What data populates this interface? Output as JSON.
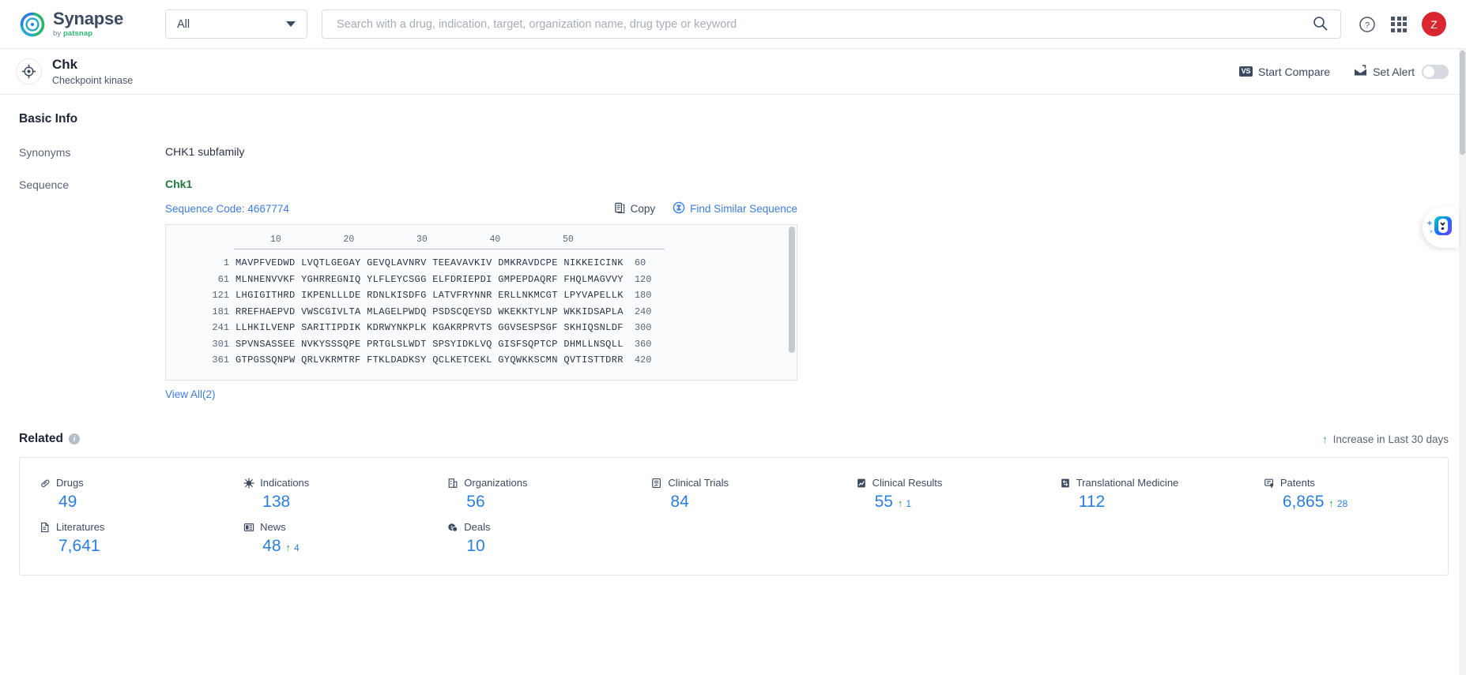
{
  "header": {
    "logo_name": "Synapse",
    "logo_sub_prefix": "by ",
    "logo_sub_brand": "patsnap",
    "scope_value": "All",
    "scope_icon": "chevron-down-icon",
    "search_placeholder": "Search with a drug, indication, target, organization name, drug type or keyword",
    "search_value": "",
    "search_icon": "search-icon",
    "help_icon": "help-circle-icon",
    "apps_icon": "app-grid-icon",
    "avatar_initial": "Z",
    "avatar_color": "#d9262f"
  },
  "entity": {
    "icon": "target-crosshair-icon",
    "name": "Chk",
    "subtitle": "Checkpoint kinase",
    "compare_label": "Start Compare",
    "compare_icon": "vs-icon",
    "compare_badge": "VS",
    "alert_label": "Set Alert",
    "alert_icon": "alert-envelope-icon",
    "alert_toggle_state": "off"
  },
  "basic_info": {
    "section_title": "Basic Info",
    "synonyms_label": "Synonyms",
    "synonyms_value": "CHK1 subfamily",
    "sequence_label": "Sequence",
    "sequence_name": "Chk1",
    "sequence_code": "Sequence Code: 4667774",
    "copy_label": "Copy",
    "copy_icon": "copy-icon",
    "find_similar_label": "Find Similar Sequence",
    "find_similar_icon": "find-similar-icon",
    "view_all_label": "View All(2)",
    "ruler_ticks": [
      "10",
      "20",
      "30",
      "40",
      "50"
    ],
    "sequence_rows": [
      {
        "start": "1",
        "blocks": [
          "MAVPFVEDWD",
          "LVQTLGEGAY",
          "GEVQLAVNRV",
          "TEEAVAVKIV",
          "DMKRAVDCPE",
          "NIKKEICINK"
        ],
        "end": "60"
      },
      {
        "start": "61",
        "blocks": [
          "MLNHENVVKF",
          "YGHRREGNIQ",
          "YLFLEYCSGG",
          "ELFDRIEPDI",
          "GMPEPDAQRF",
          "FHQLMAGVVY"
        ],
        "end": "120"
      },
      {
        "start": "121",
        "blocks": [
          "LHGIGITHRD",
          "IKPENLLLDE",
          "RDNLKISDFG",
          "LATVFRYNNR",
          "ERLLNKMCGT",
          "LPYVAPELLK"
        ],
        "end": "180"
      },
      {
        "start": "181",
        "blocks": [
          "RREFHAEPVD",
          "VWSCGIVLTA",
          "MLAGELPWDQ",
          "PSDSCQEYSD",
          "WKEKKTYLNP",
          "WKKIDSAPLA"
        ],
        "end": "240"
      },
      {
        "start": "241",
        "blocks": [
          "LLHKILVENP",
          "SARITIPDIK",
          "KDRWYNKPLK",
          "KGAKRPRVTS",
          "GGVSESPSGF",
          "SKHIQSNLDF"
        ],
        "end": "300"
      },
      {
        "start": "301",
        "blocks": [
          "SPVNSASSEE",
          "NVKYSSSQPE",
          "PRTGLSLWDT",
          "SPSYIDKLVQ",
          "GISFSQPTCP",
          "DHMLLNSQLL"
        ],
        "end": "360"
      },
      {
        "start": "361",
        "blocks": [
          "GTPGSSQNPW",
          "QRLVKRMTRF",
          "FTKLDADKSY",
          "QCLKETCEKL",
          "GYQWKKSCMN",
          "QVTISTTDRR"
        ],
        "end": "420"
      }
    ]
  },
  "related": {
    "title": "Related",
    "info_icon": "info-icon",
    "legend_icon": "up-arrow-icon",
    "legend_label": "Increase in Last 30 days",
    "items": [
      {
        "label": "Drugs",
        "icon": "capsule-icon",
        "value": "49",
        "delta": ""
      },
      {
        "label": "Indications",
        "icon": "virus-icon",
        "value": "138",
        "delta": ""
      },
      {
        "label": "Organizations",
        "icon": "building-icon",
        "value": "56",
        "delta": ""
      },
      {
        "label": "Clinical Trials",
        "icon": "clinical-trial-icon",
        "value": "84",
        "delta": ""
      },
      {
        "label": "Clinical Results",
        "icon": "results-chart-icon",
        "value": "55",
        "delta": "1"
      },
      {
        "label": "Translational Medicine",
        "icon": "translational-icon",
        "value": "112",
        "delta": ""
      },
      {
        "label": "Patents",
        "icon": "patent-icon",
        "value": "6,865",
        "delta": "28"
      },
      {
        "label": "Literatures",
        "icon": "document-icon",
        "value": "7,641",
        "delta": ""
      },
      {
        "label": "News",
        "icon": "news-icon",
        "value": "48",
        "delta": "4"
      },
      {
        "label": "Deals",
        "icon": "deals-icon",
        "value": "10",
        "delta": ""
      }
    ]
  },
  "widgets": {
    "ai_assistant_icon": "ai-assistant-icon"
  }
}
